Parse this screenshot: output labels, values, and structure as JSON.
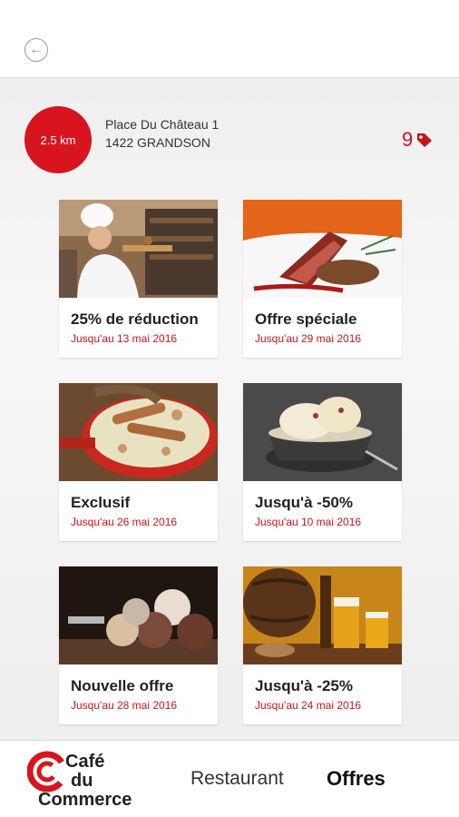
{
  "header": {
    "back_icon": "arrow-left-icon"
  },
  "restaurant": {
    "distance": "2.5 km",
    "address_line1": "Place Du Château 1",
    "address_line2": "1422 GRANDSON",
    "offers_count": "9",
    "accent_color": "#d8141e"
  },
  "offers": [
    {
      "title": "25% de réduction",
      "date": "Jusqu'au 13 mai 2016",
      "image": "chef-baking-photo"
    },
    {
      "title": "Offre spéciale",
      "date": "Jusqu'au 29 mai 2016",
      "image": "duck-breast-dish-photo"
    },
    {
      "title": "Exclusif",
      "date": "Jusqu'au 26 mai 2016",
      "image": "sausage-sauerkraut-pan-photo"
    },
    {
      "title": "Jusqu'à -50%",
      "date": "Jusqu'au 10 mai 2016",
      "image": "ice-cream-bowl-photo"
    },
    {
      "title": "Nouvelle offre",
      "date": "Jusqu'au 28 mai 2016",
      "image": "ice-cream-scoops-photo"
    },
    {
      "title": "Jusqu'à -25%",
      "date": "Jusqu'au 24 mai 2016",
      "image": "beer-barrel-photo"
    }
  ],
  "bottom_nav": {
    "logo_line1": "Café",
    "logo_line2": "du",
    "logo_line3": "Commerce",
    "restaurant_label": "Restaurant",
    "offres_label": "Offres"
  }
}
